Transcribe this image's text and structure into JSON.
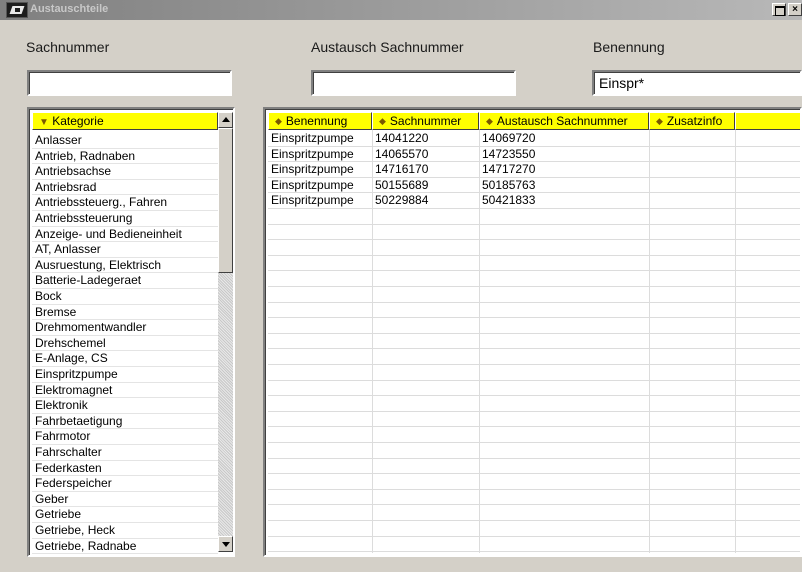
{
  "window": {
    "title": "Austauschteile",
    "controls": {
      "maximize_icon": "maximize-icon",
      "close_label": "×"
    }
  },
  "filters": {
    "sachnummer": {
      "label": "Sachnummer",
      "value": ""
    },
    "austausch": {
      "label": "Austausch Sachnummer",
      "value": ""
    },
    "benennung": {
      "label": "Benennung",
      "value": "Einspr*"
    }
  },
  "category_list": {
    "header": "Kategorie",
    "sort_icon": "sort-down-triangle-icon",
    "items": [
      "Anlasser",
      "Antrieb, Radnaben",
      "Antriebsachse",
      "Antriebsrad",
      "Antriebssteuerg., Fahren",
      "Antriebssteuerung",
      "Anzeige- und Bedieneinheit",
      "AT, Anlasser",
      "Ausruestung, Elektrisch",
      "Batterie-Ladegeraet",
      "Bock",
      "Bremse",
      "Drehmomentwandler",
      "Drehschemel",
      "E-Anlage, CS",
      "Einspritzpumpe",
      "Elektromagnet",
      "Elektronik",
      "Fahrbetaetigung",
      "Fahrmotor",
      "Fahrschalter",
      "Federkasten",
      "Federspeicher",
      "Geber",
      "Getriebe",
      "Getriebe, Heck",
      "Getriebe, Radnabe"
    ]
  },
  "results_table": {
    "columns": [
      {
        "label": "Benennung"
      },
      {
        "label": "Sachnummer"
      },
      {
        "label": "Austausch Sachnummer"
      },
      {
        "label": "Zusatzinfo"
      },
      {
        "label": ""
      }
    ],
    "sort_icon": "diamond-sort-icon",
    "rows": [
      [
        "Einspritzpumpe",
        "14041220",
        "14069720",
        "",
        ""
      ],
      [
        "Einspritzpumpe",
        "14065570",
        "14723550",
        "",
        ""
      ],
      [
        "Einspritzpumpe",
        "14716170",
        "14717270",
        "",
        ""
      ],
      [
        "Einspritzpumpe",
        "50155689",
        "50185763",
        "",
        ""
      ],
      [
        "Einspritzpumpe",
        "50229884",
        "50421833",
        "",
        ""
      ]
    ]
  },
  "colors": {
    "header_yellow": "#ffff00",
    "window_bg": "#d4d0c8",
    "titlebar_inactive": "#808080"
  }
}
